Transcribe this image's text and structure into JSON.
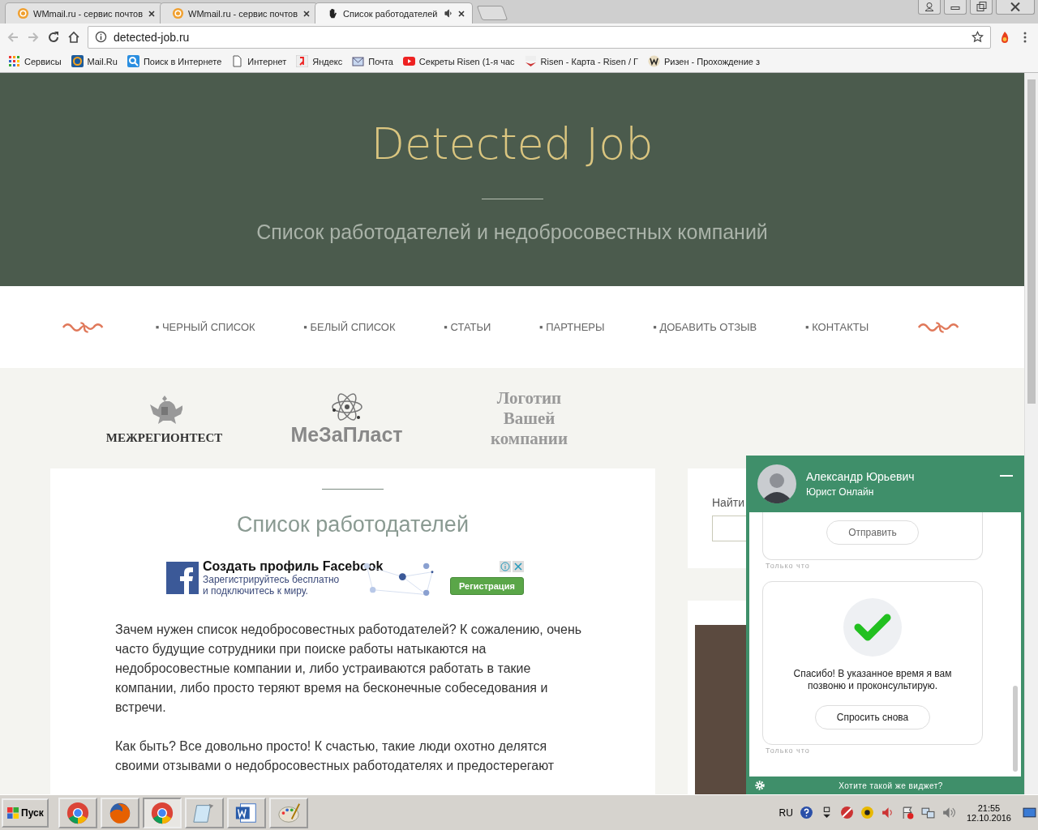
{
  "browser": {
    "tabs": [
      {
        "title": "WMmail.ru - сервис почтов",
        "kind": "mail",
        "audio": false,
        "selected": false
      },
      {
        "title": "WMmail.ru - сервис почтов",
        "kind": "mail",
        "audio": false,
        "selected": false
      },
      {
        "title": "Список работодателей",
        "kind": "hand",
        "audio": true,
        "selected": true
      }
    ],
    "address": "detected-job.ru",
    "bookmarks": [
      {
        "label": "Сервисы",
        "kind": "apps"
      },
      {
        "label": "Mail.Ru",
        "kind": "at"
      },
      {
        "label": "Поиск в Интернете",
        "kind": "search"
      },
      {
        "label": "Интернет",
        "kind": "page"
      },
      {
        "label": "Яндекс",
        "kind": "ya"
      },
      {
        "label": "Почта",
        "kind": "envelope"
      },
      {
        "label": "Секреты Risen (1-я час",
        "kind": "video"
      },
      {
        "label": "Risen - Карта - Risen / Г",
        "kind": "rpg"
      },
      {
        "label": "Ризен - Прохождение з",
        "kind": "w"
      }
    ]
  },
  "site": {
    "title": "Detected Job",
    "subtitle": "Список работодателей и недобросовестных компаний",
    "nav": [
      {
        "label": "▪ ЧЕРНЫЙ СПИСОК"
      },
      {
        "label": "▪ БЕЛЫЙ СПИСОК"
      },
      {
        "label": "▪ СТАТЬИ"
      },
      {
        "label": "▪ ПАРТНЕРЫ"
      },
      {
        "label": "▪ ДОБАВИТЬ ОТЗЫВ"
      },
      {
        "label": "▪ КОНТАКТЫ"
      }
    ],
    "partners": [
      {
        "label": "МЕЖРЕГИОНТЕСТ",
        "kind": "eagle"
      },
      {
        "label": "МеЗаПласт",
        "kind": "atom"
      },
      {
        "label": "Логотип Вашей компании",
        "kind": "text"
      }
    ],
    "article": {
      "heading": "Список работодателей",
      "ad": {
        "title": "Создать профиль Facebook",
        "line_1": "Зарегистрируйтесь бесплатно",
        "line_2": "и подключитесь к миру.",
        "button": "Регистрация"
      },
      "paragraphs": [
        "Зачем нужен список недобросовестных работодателей? К сожалению, очень часто будущие сотрудники при поиске работы натыкаются на недобросовестные компании и, либо устраиваются работать в такие компании, либо просто теряют время на бесконечные собеседования и встречи.",
        "Как быть? Все довольно просто! К счастью, такие люди охотно делятся своими отзывами о недобросовестных работодателях и предостерегают"
      ]
    },
    "sidebar": {
      "search_label": "Найти"
    }
  },
  "chat": {
    "name": "Александр Юрьевич",
    "role": "Юрист Онлайн",
    "messages": [
      {
        "kind": "button",
        "button": "Отправить",
        "time": "Только что"
      },
      {
        "kind": "success",
        "text": "Спасибо! В указанное время я вам позвоню и проконсультирую.",
        "button": "Спросить снова",
        "time": "Только что"
      }
    ],
    "footer": "Хотите такой же виджет?"
  },
  "taskbar": {
    "start": "Пуск",
    "apps": [
      {
        "kind": "chrome",
        "selected": false
      },
      {
        "kind": "firefox",
        "selected": false
      },
      {
        "kind": "chrome",
        "selected": true
      },
      {
        "kind": "notepad",
        "selected": false
      },
      {
        "kind": "word",
        "selected": false
      },
      {
        "kind": "paint",
        "selected": false
      }
    ],
    "language": "RU",
    "time": "21:55",
    "date": "12.10.2016"
  }
}
